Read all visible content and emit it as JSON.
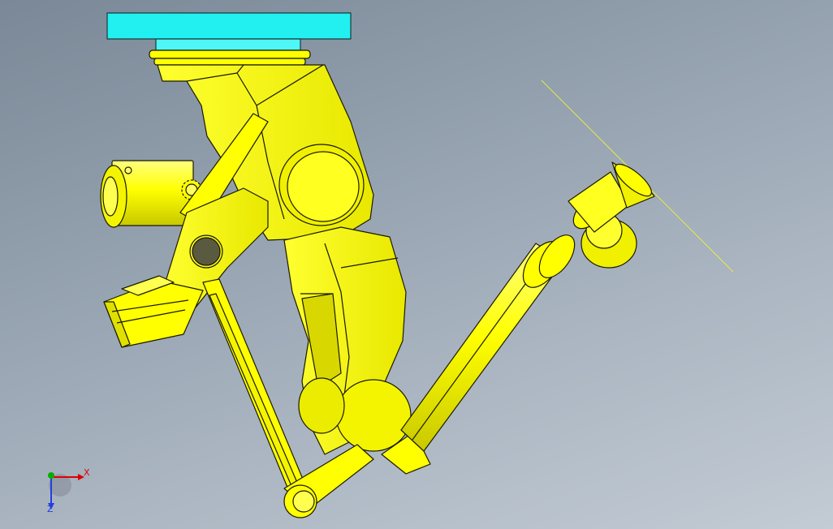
{
  "viewport": {
    "background_top": "#7a8897",
    "background_bottom": "#c3cbd4"
  },
  "model": {
    "part_color": "#ffff00",
    "part_shade": "#e6e600",
    "edge_color": "#1a1a00",
    "flange_color": "#22f0f0",
    "sketch_line_color": "#e8e84a"
  },
  "triad": {
    "x_label": "X",
    "z_label": "Z",
    "x_color": "#e00000",
    "y_color": "#00b000",
    "z_color": "#2040e0",
    "icon": "coordinate-triad-icon"
  }
}
